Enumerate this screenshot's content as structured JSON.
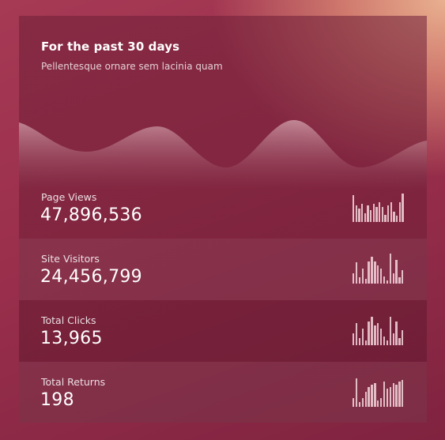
{
  "card": {
    "title": "For the past 30 days",
    "subtitle": "Pellentesque ornare sem lacinia quam"
  },
  "stats": [
    {
      "label": "Page Views",
      "value": "47,896,536",
      "bars": [
        0.9,
        0.55,
        0.45,
        0.6,
        0.3,
        0.55,
        0.4,
        0.6,
        0.5,
        0.65,
        0.5,
        0.25,
        0.55,
        0.65,
        0.35,
        0.2,
        0.65,
        0.95
      ]
    },
    {
      "label": "Site Visitors",
      "value": "24,456,799",
      "bars": [
        0.35,
        0.7,
        0.2,
        0.5,
        0.15,
        0.75,
        0.9,
        0.75,
        0.6,
        0.5,
        0.25,
        0.1,
        1.0,
        0.35,
        0.8,
        0.2,
        0.45
      ]
    },
    {
      "label": "Total Clicks",
      "value": "13,965",
      "bars": [
        0.4,
        0.75,
        0.25,
        0.55,
        0.15,
        0.8,
        0.95,
        0.65,
        0.75,
        0.55,
        0.3,
        0.15,
        0.95,
        0.4,
        0.8,
        0.25,
        0.5
      ]
    },
    {
      "label": "Total Returns",
      "value": "198",
      "bars": [
        0.3,
        0.95,
        0.15,
        0.3,
        0.5,
        0.65,
        0.75,
        0.8,
        0.2,
        0.3,
        0.85,
        0.6,
        0.65,
        0.8,
        0.75,
        0.85,
        0.9
      ]
    }
  ]
}
